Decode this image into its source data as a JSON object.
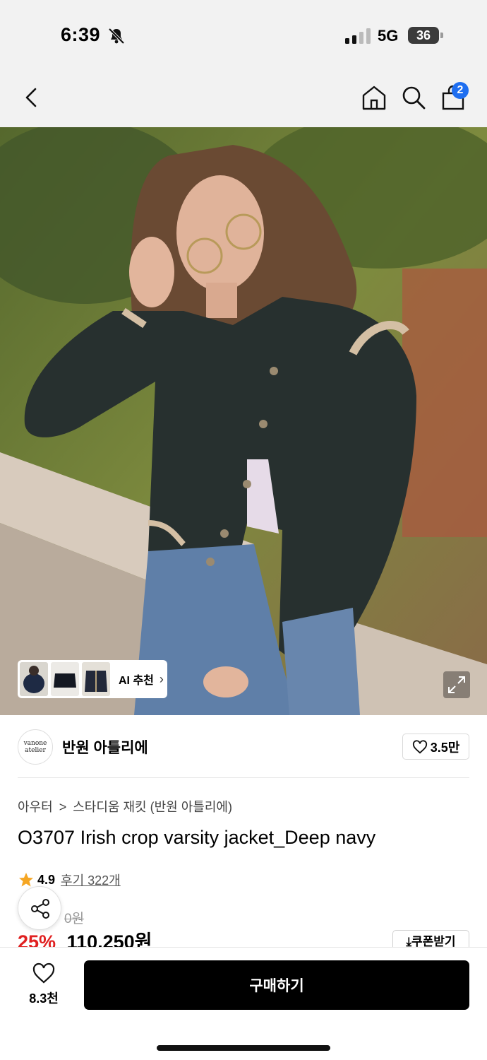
{
  "status_bar": {
    "time": "6:39",
    "network": "5G",
    "battery": "36",
    "icons": [
      "bell-slash-icon",
      "signal-icon",
      "battery-icon"
    ]
  },
  "nav": {
    "cart_badge": "2",
    "icons": [
      "back-icon",
      "home-icon",
      "search-icon",
      "shopping-bag-icon"
    ],
    "badge_color": "#1e6ef0"
  },
  "hero": {
    "ai_recommend_label": "AI 추천",
    "icons": [
      "expand-icon",
      "chevron-right-icon"
    ]
  },
  "brand": {
    "logo_text": "vanone atelier",
    "name": "반원 아틀리에",
    "like_count": "3.5만"
  },
  "product": {
    "breadcrumb_category": "아우터",
    "breadcrumb_sep": ">",
    "breadcrumb_sub": "스타디움 재킷 (반원 아틀리에)",
    "title": "O3707 Irish crop varsity jacket_Deep navy",
    "rating": "4.9",
    "reviews": "후기 322개",
    "original_price_partial": "0원",
    "discount": "25%",
    "price": "110,250원",
    "coupon_label": "쿠폰받기",
    "star_color": "#f5a623",
    "discount_color": "#e02020"
  },
  "bottom_bar": {
    "wish_count": "8.3천",
    "buy_label": "구매하기"
  }
}
